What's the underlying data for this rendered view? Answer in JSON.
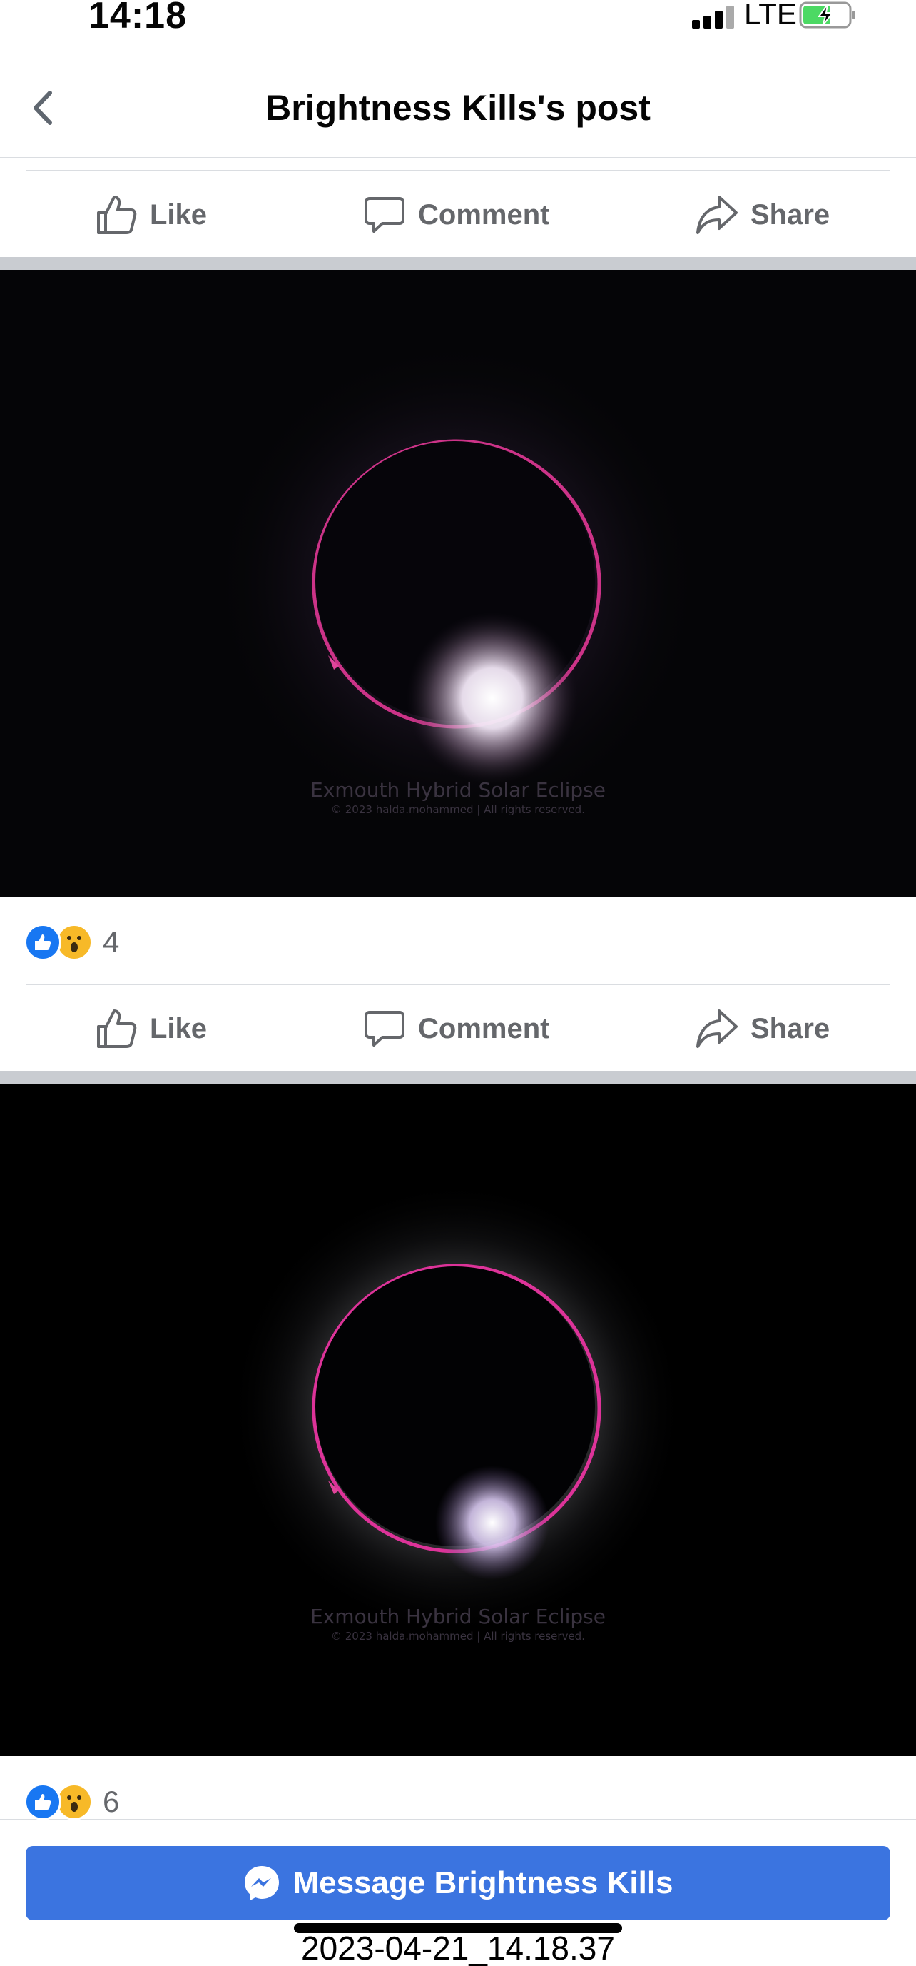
{
  "status_bar": {
    "time": "14:18",
    "network": "LTE",
    "battery_icon": "battery-charging-icon",
    "battery_color": "#4cd964"
  },
  "header": {
    "title": "Brightness Kills's post",
    "back_icon": "chevron-left-icon"
  },
  "actions": {
    "like": "Like",
    "comment": "Comment",
    "share": "Share"
  },
  "posts": [
    {
      "image_watermark_title": "Exmouth Hybrid Solar Eclipse",
      "image_watermark_sub": "© 2023 halda.mohammed | All rights reserved.",
      "reaction_count": "4"
    },
    {
      "image_watermark_title": "Exmouth Hybrid Solar Eclipse",
      "image_watermark_sub": "© 2023 halda.mohammed | All rights reserved.",
      "reaction_count": "6"
    }
  ],
  "bottom": {
    "message_button": "Message Brightness Kills",
    "timestamp": "2023-04-21_14.18.37"
  },
  "colors": {
    "accent": "#3b74e0",
    "like_blue": "#1877f2",
    "wow_yellow": "#f7b928",
    "muted_text": "#65676b"
  }
}
